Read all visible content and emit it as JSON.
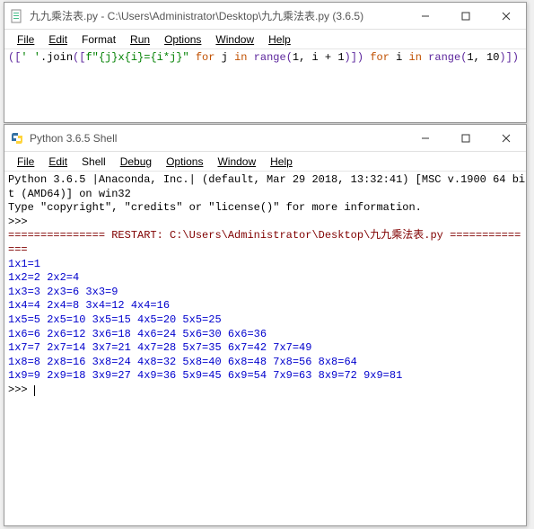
{
  "editor": {
    "title": "九九乘法表.py - C:\\Users\\Administrator\\Desktop\\九九乘法表.py (3.6.5)",
    "menu": {
      "file": "File",
      "edit": "Edit",
      "format": "Format",
      "run": "Run",
      "options": "Options",
      "window": "Window",
      "help": "Help"
    },
    "code": {
      "open": "([",
      "str1": "' '",
      "dot": ".",
      "join": "join",
      "p2": "([",
      "fstr": "f\"{j}x{i}={i*j}\"",
      "for1": " for ",
      "j": "j",
      "in1": " in ",
      "range1": "range",
      "p3": "(",
      "n1": "1",
      "c1": ", ",
      "iexpr": "i + 1",
      "p4": ")]) ",
      "for2": "for ",
      "i": "i",
      "in2": " in ",
      "range2": "range",
      "p5": "(",
      "n1b": "1",
      "c2": ", ",
      "n10": "10",
      "p6": ")])"
    }
  },
  "shell": {
    "title": "Python 3.6.5 Shell",
    "menu": {
      "file": "File",
      "edit": "Edit",
      "shell": "Shell",
      "debug": "Debug",
      "options": "Options",
      "window": "Window",
      "help": "Help"
    },
    "banner1": "Python 3.6.5 |Anaconda, Inc.| (default, Mar 29 2018, 13:32:41) [MSC v.1900 64 bi",
    "banner2": "t (AMD64)] on win32",
    "banner3": "Type \"copyright\", \"credits\" or \"license()\" for more information.",
    "prompt1": ">>> ",
    "restart_line": "=============== RESTART: C:\\Users\\Administrator\\Desktop\\九九乘法表.py ===========",
    "restart_tail": "===",
    "lines": [
      "1x1=1",
      "1x2=2 2x2=4",
      "1x3=3 2x3=6 3x3=9",
      "1x4=4 2x4=8 3x4=12 4x4=16",
      "1x5=5 2x5=10 3x5=15 4x5=20 5x5=25",
      "1x6=6 2x6=12 3x6=18 4x6=24 5x6=30 6x6=36",
      "1x7=7 2x7=14 3x7=21 4x7=28 5x7=35 6x7=42 7x7=49",
      "1x8=8 2x8=16 3x8=24 4x8=32 5x8=40 6x8=48 7x8=56 8x8=64",
      "1x9=9 2x9=18 3x9=27 4x9=36 5x9=45 6x9=54 7x9=63 8x9=72 9x9=81"
    ],
    "prompt2": ">>> "
  },
  "chart_data": {
    "type": "table",
    "title": "九九乘法表 (9×9 multiplication table)",
    "categories": [
      1,
      2,
      3,
      4,
      5,
      6,
      7,
      8,
      9
    ],
    "series": [
      {
        "name": "1",
        "values": [
          1
        ]
      },
      {
        "name": "2",
        "values": [
          2,
          4
        ]
      },
      {
        "name": "3",
        "values": [
          3,
          6,
          9
        ]
      },
      {
        "name": "4",
        "values": [
          4,
          8,
          12,
          16
        ]
      },
      {
        "name": "5",
        "values": [
          5,
          10,
          15,
          20,
          25
        ]
      },
      {
        "name": "6",
        "values": [
          6,
          12,
          18,
          24,
          30,
          36
        ]
      },
      {
        "name": "7",
        "values": [
          7,
          14,
          21,
          28,
          35,
          42,
          49
        ]
      },
      {
        "name": "8",
        "values": [
          8,
          16,
          24,
          32,
          40,
          48,
          56,
          64
        ]
      },
      {
        "name": "9",
        "values": [
          9,
          18,
          27,
          36,
          45,
          54,
          63,
          72,
          81
        ]
      }
    ]
  }
}
